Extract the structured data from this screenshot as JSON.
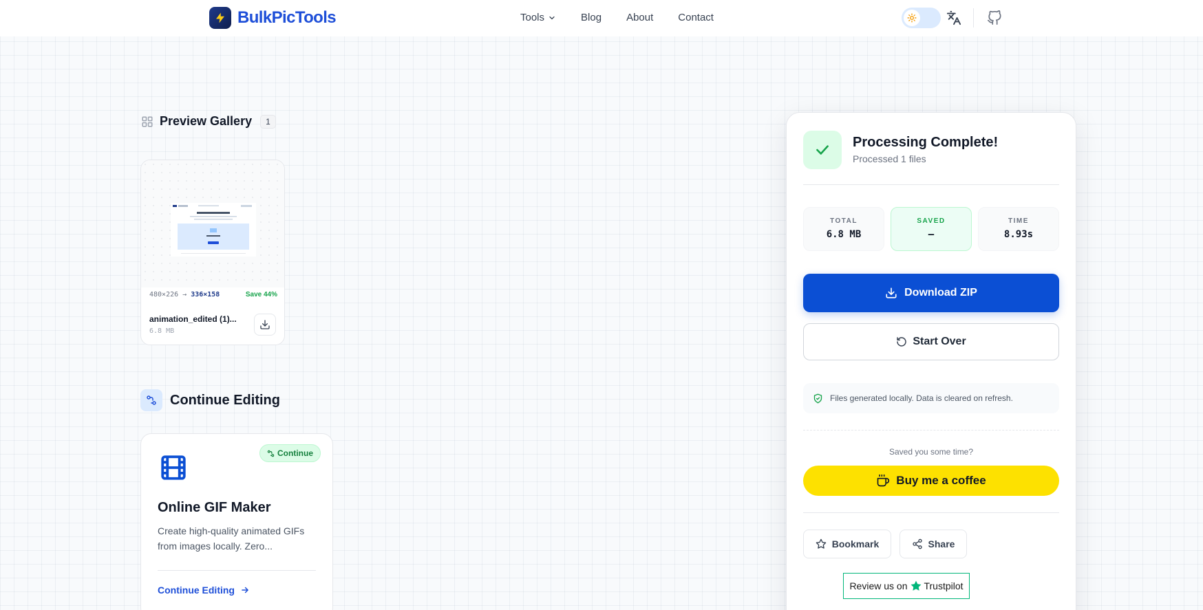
{
  "header": {
    "logo_text": "BulkPicTools",
    "nav": {
      "tools": "Tools",
      "blog": "Blog",
      "about": "About",
      "contact": "Contact"
    }
  },
  "gallery": {
    "title": "Preview Gallery",
    "count": "1",
    "item": {
      "original_dims": "480×226",
      "new_dims": "336×158",
      "savings": "Save 44%",
      "file_name": "animation_edited (1)...",
      "file_size": "6.8 MB"
    }
  },
  "continue_editing": {
    "title": "Continue Editing",
    "card": {
      "badge": "Continue",
      "title": "Online GIF Maker",
      "description": "Create high-quality animated GIFs from images locally. Zero...",
      "link": "Continue Editing"
    }
  },
  "panel": {
    "title": "Processing Complete!",
    "subtitle": "Processed 1 files",
    "stats": {
      "total_label": "TOTAL",
      "total_value": "6.8 MB",
      "saved_label": "SAVED",
      "saved_value": "–",
      "time_label": "TIME",
      "time_value": "8.93s"
    },
    "download_label": "Download ZIP",
    "start_over_label": "Start Over",
    "local_note": "Files generated locally. Data is cleared on refresh.",
    "saved_time_text": "Saved you some time?",
    "coffee_label": "Buy me a coffee",
    "bookmark_label": "Bookmark",
    "share_label": "Share",
    "trustpilot": {
      "prefix": "Review us on",
      "brand": "Trustpilot"
    }
  },
  "colors": {
    "brand": "#1d4ed8",
    "primary_button": "#0b4fd4",
    "success": "#16a34a",
    "coffee": "#fde100",
    "trustpilot": "#00b67a"
  },
  "icons": {
    "logo": "lightning-bolt-icon",
    "theme": "sun-icon",
    "translate": "translate-icon",
    "github": "github-icon",
    "gallery": "grid-icon",
    "download": "download-icon",
    "restart": "rotate-ccw-icon",
    "note": "shield-check-icon",
    "coffee": "coffee-cup-icon",
    "bookmark": "star-icon",
    "share": "share-icon",
    "tool": "film-icon"
  }
}
